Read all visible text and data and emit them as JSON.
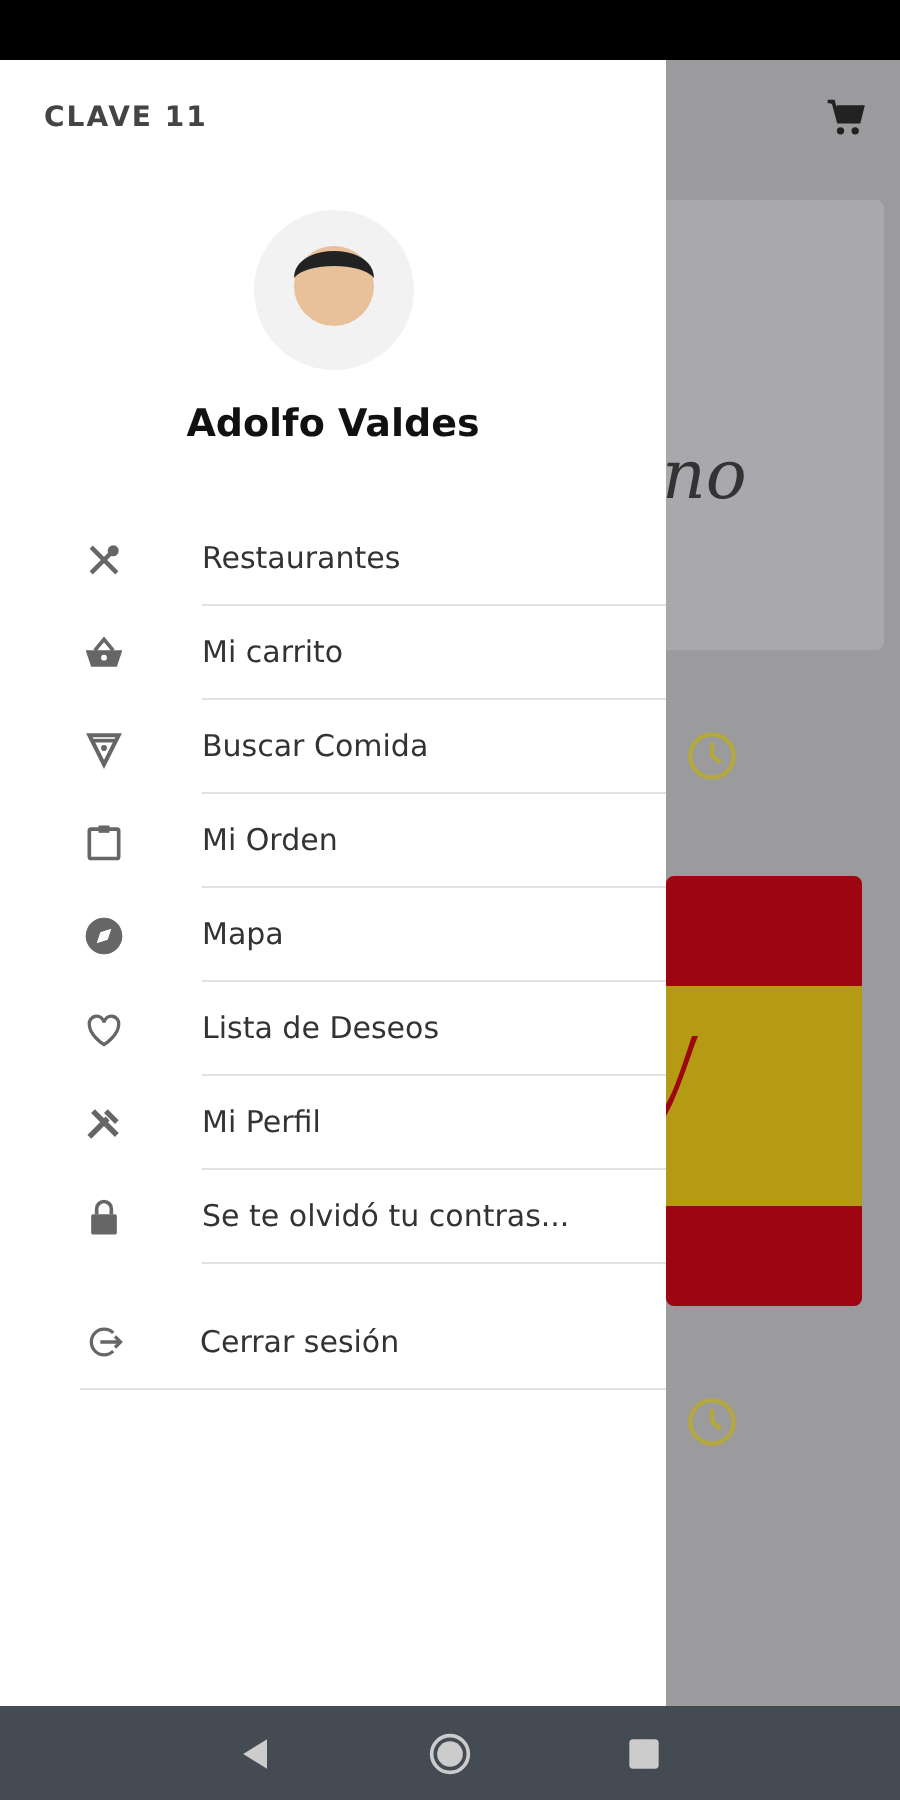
{
  "drawer": {
    "brand": "CLAVE 11",
    "user_name": "Adolfo Valdes",
    "items": [
      {
        "kind": "utensils",
        "label": "Restaurantes"
      },
      {
        "kind": "basket",
        "label": "Mi carrito"
      },
      {
        "kind": "pizza",
        "label": "Buscar Comida"
      },
      {
        "kind": "clipboard",
        "label": "Mi Orden"
      },
      {
        "kind": "compass",
        "label": "Mapa"
      },
      {
        "kind": "heart",
        "label": "Lista de Deseos"
      },
      {
        "kind": "tools",
        "label": "Mi Perfil"
      },
      {
        "kind": "lock",
        "label": "Se te olvidó tu contras..."
      }
    ],
    "logout": {
      "kind": "logout",
      "label": "Cerrar sesión"
    }
  },
  "background": {
    "card_text": "no"
  }
}
